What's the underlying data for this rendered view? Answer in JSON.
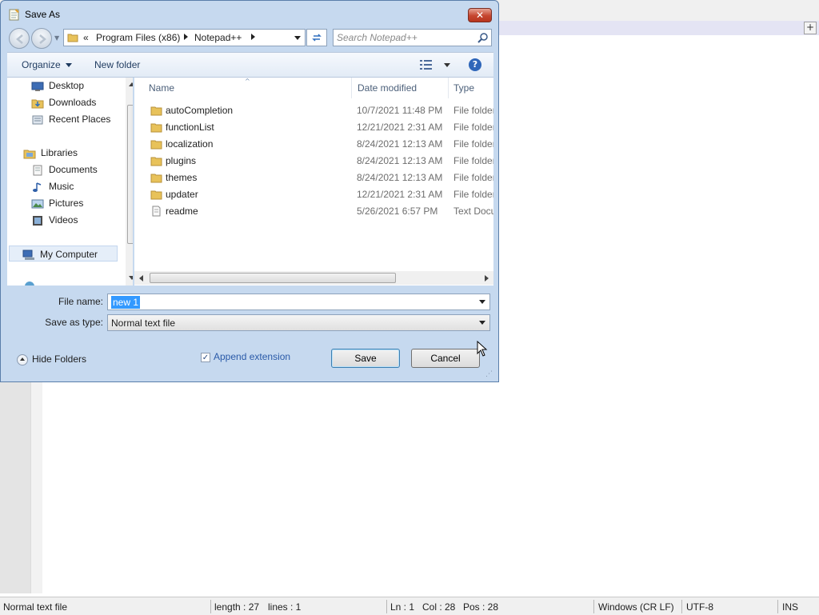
{
  "dialog": {
    "title": "Save As",
    "close_label": "✕",
    "address": {
      "overflow": "«",
      "crumbs": [
        "Program Files (x86)",
        "Notepad++"
      ]
    },
    "search": {
      "placeholder": "Search Notepad++"
    },
    "toolbar": {
      "organize": "Organize",
      "new_folder": "New folder",
      "help": "?"
    },
    "nav": {
      "items": [
        {
          "label": "Desktop",
          "icon": "desktop-icon"
        },
        {
          "label": "Downloads",
          "icon": "downloads-folder-icon"
        },
        {
          "label": "Recent Places",
          "icon": "recent-places-icon"
        },
        {
          "label": "Libraries",
          "icon": "libraries-icon"
        },
        {
          "label": "Documents",
          "icon": "documents-icon"
        },
        {
          "label": "Music",
          "icon": "music-icon"
        },
        {
          "label": "Pictures",
          "icon": "pictures-icon"
        },
        {
          "label": "Videos",
          "icon": "videos-icon"
        },
        {
          "label": "My Computer",
          "icon": "computer-icon",
          "selected": true
        }
      ]
    },
    "files": {
      "columns": [
        "Name",
        "Date modified",
        "Type"
      ],
      "rows": [
        {
          "name": "autoCompletion",
          "date": "10/7/2021 11:48 PM",
          "type": "File folder",
          "kind": "folder"
        },
        {
          "name": "functionList",
          "date": "12/21/2021 2:31 AM",
          "type": "File folder",
          "kind": "folder"
        },
        {
          "name": "localization",
          "date": "8/24/2021 12:13 AM",
          "type": "File folder",
          "kind": "folder"
        },
        {
          "name": "plugins",
          "date": "8/24/2021 12:13 AM",
          "type": "File folder",
          "kind": "folder"
        },
        {
          "name": "themes",
          "date": "8/24/2021 12:13 AM",
          "type": "File folder",
          "kind": "folder"
        },
        {
          "name": "updater",
          "date": "12/21/2021 2:31 AM",
          "type": "File folder",
          "kind": "folder"
        },
        {
          "name": "readme",
          "date": "5/26/2021 6:57 PM",
          "type": "Text Document",
          "kind": "text"
        }
      ]
    },
    "file_name": {
      "label": "File name:",
      "value": "new 1"
    },
    "save_type": {
      "label": "Save as type:",
      "value": "Normal text file"
    },
    "hide_folders": "Hide Folders",
    "append_extension": {
      "label": "Append extension",
      "checked": true
    },
    "save_button": "Save",
    "cancel_button": "Cancel"
  },
  "notepad": {
    "status": {
      "file_type": "Normal text file",
      "length": "length : 27",
      "lines": "lines : 1",
      "ln": "Ln : 1",
      "col": "Col : 28",
      "pos": "Pos : 28",
      "eol": "Windows (CR LF)",
      "encoding": "UTF-8",
      "mode": "INS"
    },
    "tab_plus": "+"
  },
  "colors": {
    "dialog_frame": "#c6d9ef",
    "selection": "#3399ff",
    "link_blue": "#2a5aa8"
  }
}
